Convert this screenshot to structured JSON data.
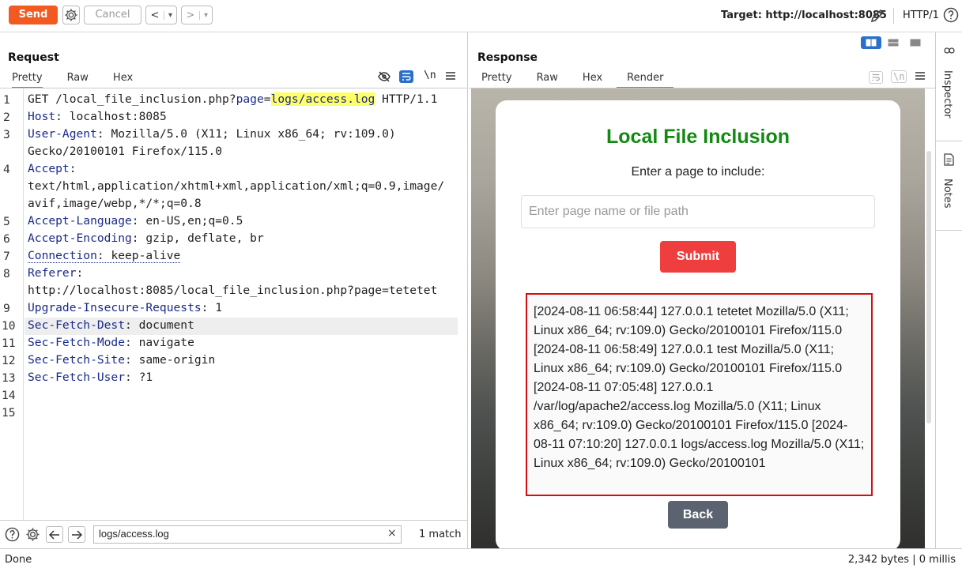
{
  "toolbar": {
    "send_label": "Send",
    "cancel_label": "Cancel",
    "back_arrow": "<",
    "forward_arrow": ">",
    "dropdown_arrow": "▾",
    "target_label": "Target: http://localhost:8085",
    "protocol": "HTTP/1"
  },
  "request": {
    "title": "Request",
    "tabs": [
      "Pretty",
      "Raw",
      "Hex"
    ],
    "active_tab": "Pretty",
    "newline_toggle": "\\n",
    "line_numbers": [
      "1",
      "2",
      "3",
      "4",
      "5",
      "6",
      "7",
      "8",
      "9",
      "10",
      "11",
      "12",
      "13",
      "14",
      "15"
    ],
    "lines": {
      "l1_method": "GET /local_file_inclusion.php?",
      "l1_param": "page",
      "l1_eq": "=",
      "l1_value": "logs/access.log",
      "l1_proto": " HTTP/1.1",
      "l2_key": "Host",
      "l2_val": ": localhost:8085",
      "l3_key": "User-Agent",
      "l3_val": ": Mozilla/5.0 (X11; Linux x86_64; rv:109.0)",
      "l3_cont": "Gecko/20100101 Firefox/115.0",
      "l4_key": "Accept",
      "l4_val": ":",
      "l4_cont1": "text/html,application/xhtml+xml,application/xml;q=0.9,image/",
      "l4_cont2": "avif,image/webp,*/*;q=0.8",
      "l5_key": "Accept-Language",
      "l5_val": ": en-US,en;q=0.5",
      "l6_key": "Accept-Encoding",
      "l6_val": ": gzip, deflate, br",
      "l7_key": "Connection",
      "l7_val": ": keep-alive",
      "l8_key": "Referer",
      "l8_val": ":",
      "l8_cont": "http://localhost:8085/local_file_inclusion.php?page=tetetet",
      "l9_key": "Upgrade-Insecure-Requests",
      "l9_val": ": 1",
      "l10_key": "Sec-Fetch-Dest",
      "l10_val": ": document",
      "l11_key": "Sec-Fetch-Mode",
      "l11_val": ": navigate",
      "l12_key": "Sec-Fetch-Site",
      "l12_val": ": same-origin",
      "l13_key": "Sec-Fetch-User",
      "l13_val": ": ?1"
    },
    "search_value": "logs/access.log",
    "search_clear": "×",
    "match_count": "1 match"
  },
  "response": {
    "title": "Response",
    "tabs": [
      "Pretty",
      "Raw",
      "Hex",
      "Render"
    ],
    "active_tab": "Render",
    "newline_toggle": "\\n",
    "render": {
      "heading": "Local File Inclusion",
      "subheading": "Enter a page to include:",
      "input_placeholder": "Enter page name or file path",
      "submit_label": "Submit",
      "log_text": "[2024-08-11 06:58:44] 127.0.0.1 tetetet Mozilla/5.0 (X11; Linux x86_64; rv:109.0) Gecko/20100101 Firefox/115.0 [2024-08-11 06:58:49] 127.0.0.1 test Mozilla/5.0 (X11; Linux x86_64; rv:109.0) Gecko/20100101 Firefox/115.0 [2024-08-11 07:05:48] 127.0.0.1 /var/log/apache2/access.log Mozilla/5.0 (X11; Linux x86_64; rv:109.0) Gecko/20100101 Firefox/115.0 [2024-08-11 07:10:20] 127.0.0.1 logs/access.log Mozilla/5.0 (X11; Linux x86_64; rv:109.0) Gecko/20100101",
      "back_label": "Back"
    }
  },
  "sidebar": {
    "inspector_label": "Inspector",
    "notes_label": "Notes"
  },
  "status": {
    "left": "Done",
    "right": "2,342 bytes | 0 millis"
  },
  "colors": {
    "accent": "#f25a22",
    "title_green": "#128a12",
    "submit_red": "#ef3e3e",
    "log_border": "#d21010",
    "back_gray": "#5c6370",
    "view_active": "#2a6fc9"
  }
}
